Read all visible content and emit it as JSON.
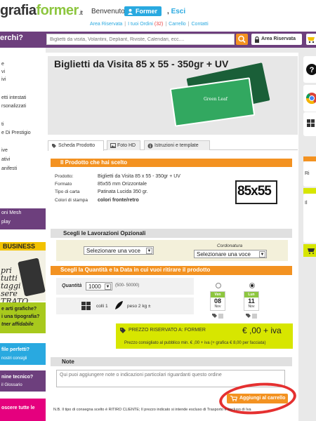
{
  "header": {
    "logo_main": "grafia",
    "logo_accent": "former",
    "logo_tld": ".it",
    "welcome": "Benvenuto",
    "user_name": "Former",
    "logout_sep": ",",
    "logout": "Esci",
    "links": [
      {
        "label": "Area Riservata"
      },
      {
        "label": "I tuoi Ordini",
        "count": "(32)"
      },
      {
        "label": "Carrello"
      },
      {
        "label": "Contatti"
      }
    ]
  },
  "search": {
    "label": "erchi?",
    "placeholder": "Biglietti da visita, Volantini, Depliant, Riviste, Calendari, ecc....",
    "area_button": "Area Riservata"
  },
  "sidebar": {
    "items": [
      "e",
      "vi",
      "ivi",
      "",
      "etti intestati",
      "rsonalizzati",
      "",
      "ti",
      "e Di Prestigio",
      "",
      "ive",
      "ativi",
      "anifesti",
      "",
      "",
      "oni Mesh",
      "play"
    ],
    "business_title": "BUSINESS",
    "business_text": "pri\ntutti\ntaggi\nsere\nTRATO",
    "green_text_1": "e arti grafiche?",
    "green_text_2": "i una tipografia?",
    "green_text_3": "tner affidabile",
    "blue_text_1": "file perfetti?",
    "blue_text_2": "nostri consigli",
    "purple_text_1": "nine tecnico?",
    "purple_text_2": "il Glossario",
    "pink_text_1": "oscere tutte le"
  },
  "product": {
    "title": "Biglietti da Visita 85 x 55 - 350gr + UV",
    "card_brand": "Green Leaf",
    "tabs": [
      "Scheda Prodotto",
      "Foto HD",
      "Istruzioni e template"
    ],
    "section_title": "Il Prodotto che hai scelto",
    "fields": [
      {
        "k": "Prodotto:",
        "v": "Biglietti da Visita 85 x 55 - 350gr + UV"
      },
      {
        "k": "Formato",
        "v": "85x55 mm Orizzontale"
      },
      {
        "k": "Tipo di carta",
        "v": "Patinata Lucida 350 gr."
      },
      {
        "k": "Colori di stampa",
        "v": "colori fronte/retro"
      }
    ],
    "size_badge": "85x55"
  },
  "options": {
    "title": "Scegli le Lavorazioni Opzionali",
    "select1": "Selezionare una voce",
    "select2_label": "Cordonatura",
    "select2": "Selezionare una voce"
  },
  "quantity": {
    "title": "Scegli la Quantità e la Data in cui vuoi ritirare il prodotto",
    "label": "Quantità",
    "value": "1000",
    "range": "(500- 50000)",
    "colli": "colli 1",
    "peso": "peso 2 kg ±",
    "dates": [
      {
        "day": "Ven",
        "num": "08",
        "month": "Nov",
        "selected": false
      },
      {
        "day": "Lun",
        "num": "11",
        "month": "Nov",
        "selected": true
      }
    ]
  },
  "price": {
    "label": "PREZZO RISERVATO A: FORMER",
    "value": "€ ,00 + iva",
    "note": "Prezzo consigliato al pubblico min. €    ,00 + iva (+ grafica € 8,00 per facciata)"
  },
  "notes": {
    "title": "Note",
    "placeholder": "Qui puoi aggiungere note o indicazioni particolari riguardanti questo ordine"
  },
  "cart_button": "Aggiungi al carrello",
  "footnote": "N.B. Il tipo di consegna scelto è RITIRO CLIENTE; Il prezzo indicato si intende escluso di Trasporto e escluso di Iva",
  "right": {
    "texts": [
      "Ri",
      "Il"
    ]
  },
  "colors": {
    "purple": "#6d3f7d",
    "orange": "#f39221",
    "green": "#8dc63f",
    "lime": "#d7e600",
    "blue": "#29a9e0"
  }
}
